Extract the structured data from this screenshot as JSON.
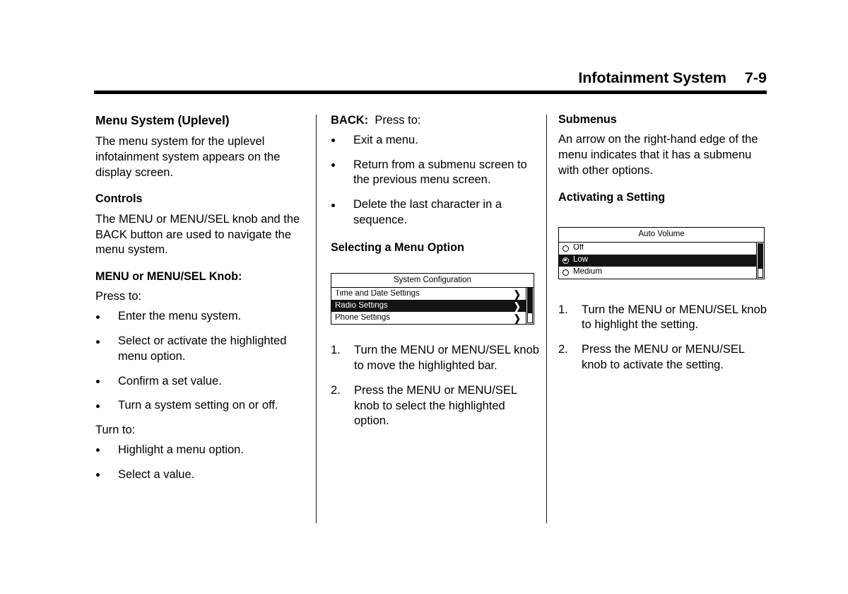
{
  "header": {
    "title": "Infotainment System",
    "page_number": "7-9"
  },
  "columns": {
    "left": {
      "section_heading": "Menu System (Uplevel)",
      "intro_paragraph": "The menu system for the uplevel infotainment system appears on the display screen.",
      "controls_heading": "Controls",
      "controls_paragraph": "The MENU or MENU/SEL knob and the BACK button are used to navigate the menu system.",
      "knob_label": "MENU or MENU/SEL Knob:",
      "press_to_label": "Press to:",
      "press_bullets": [
        "Enter the menu system.",
        "Select or activate the highlighted menu option.",
        "Confirm a set value.",
        "Turn a system setting on or off."
      ],
      "turn_to_label": "Turn to:",
      "turn_bullets": [
        "Highlight a menu option.",
        "Select a value."
      ]
    },
    "middle": {
      "back_label": "BACK:",
      "back_press_to": "Press to:",
      "back_bullets": [
        "Exit a menu.",
        "Return from a submenu screen to the previous menu screen.",
        "Delete the last character in a sequence."
      ],
      "selecting_heading": "Selecting a Menu Option",
      "figure": {
        "title": "System Configuration",
        "rows": [
          {
            "label": "Time and Date Settings",
            "chevron": "chevron-right-icon",
            "selected": false
          },
          {
            "label": "Radio Settings",
            "chevron": "chevron-right-icon",
            "selected": true
          },
          {
            "label": "Phone Settings",
            "chevron": "chevron-right-icon",
            "selected": false
          }
        ]
      },
      "steps": [
        {
          "num": "1.",
          "text": "Turn the MENU or MENU/SEL knob to move the highlighted bar."
        },
        {
          "num": "2.",
          "text": "Press the MENU or MENU/SEL knob to select the highlighted option."
        }
      ]
    },
    "right": {
      "submenus_heading": "Submenus",
      "submenus_paragraph": "An arrow on the right-hand edge of the menu indicates that it has a submenu with other options.",
      "activating_heading": "Activating a Setting",
      "figure": {
        "title": "Auto Volume",
        "rows": [
          {
            "label": "Off",
            "selected": false
          },
          {
            "label": "Low",
            "selected": true
          },
          {
            "label": "Medium",
            "selected": false
          }
        ]
      },
      "steps": [
        {
          "num": "1.",
          "text": "Turn the MENU or MENU/SEL knob to highlight the setting."
        },
        {
          "num": "2.",
          "text": "Press the MENU or MENU/SEL knob to activate the setting."
        }
      ]
    }
  },
  "colors": {
    "ink": "#000000",
    "paper": "#ffffff",
    "highlight_bar": "#131313",
    "highlight_text": "#ffffff"
  },
  "icons": {
    "chevron_right": "❯"
  }
}
